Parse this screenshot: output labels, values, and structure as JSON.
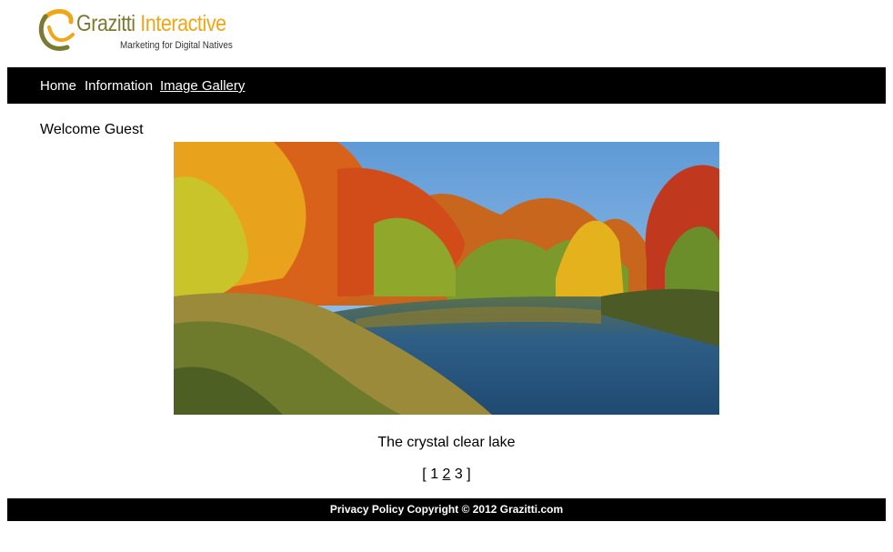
{
  "brand": {
    "name_part1": "Grazitti",
    "name_part2": " Interactive",
    "tagline": "Marketing for Digital Natives",
    "colors": {
      "olive": "#7a7a30",
      "orange": "#f2a516"
    }
  },
  "nav": {
    "items": [
      {
        "label": "Home",
        "active": false
      },
      {
        "label": "Information",
        "active": false
      },
      {
        "label": "Image Gallery",
        "active": true
      }
    ]
  },
  "welcome": "Welcome Guest",
  "gallery": {
    "caption": "The crystal clear lake",
    "pager": {
      "open": "[",
      "close": "]",
      "pages": [
        "1",
        "2",
        "3"
      ],
      "current": "2"
    }
  },
  "footer": {
    "text": "Privacy Policy Copyright © 2012 Grazitti.com"
  }
}
